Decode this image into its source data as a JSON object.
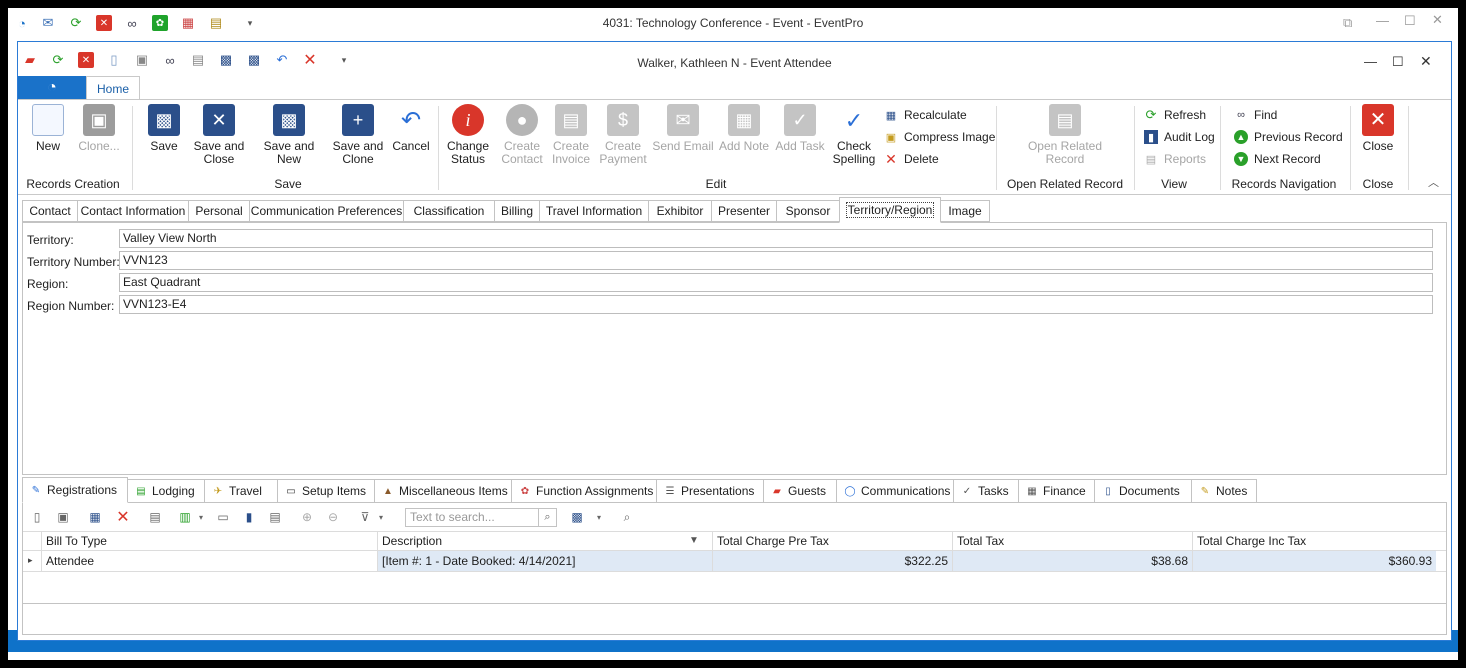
{
  "outer": {
    "title": "4031: Technology Conference - Event - EventPro"
  },
  "inner": {
    "title": "Walker, Kathleen N - Event Attendee"
  },
  "ribbon": {
    "home_tab": "Home",
    "groups": {
      "records_creation": "Records Creation",
      "save": "Save",
      "edit": "Edit",
      "open_related": "Open Related Record",
      "view": "View",
      "records_navigation": "Records Navigation",
      "close": "Close"
    },
    "buttons": {
      "new": "New",
      "clone": "Clone...",
      "save": "Save",
      "save_close_1": "Save and",
      "save_close_2": "Close",
      "save_new": "Save and New",
      "save_clone_1": "Save and",
      "save_clone_2": "Clone",
      "cancel": "Cancel",
      "change_status_1": "Change",
      "change_status_2": "Status",
      "create_contact_1": "Create",
      "create_contact_2": "Contact",
      "create_invoice_1": "Create",
      "create_invoice_2": "Invoice",
      "create_payment_1": "Create",
      "create_payment_2": "Payment",
      "send_email": "Send Email",
      "add_note": "Add Note",
      "add_task": "Add Task",
      "check_spelling_1": "Check",
      "check_spelling_2": "Spelling",
      "recalculate": "Recalculate",
      "compress_image": "Compress Image",
      "delete": "Delete",
      "open_related_1": "Open Related",
      "open_related_2": "Record",
      "refresh": "Refresh",
      "audit_log": "Audit Log",
      "reports": "Reports",
      "find": "Find",
      "previous_record": "Previous Record",
      "next_record": "Next Record",
      "close": "Close"
    }
  },
  "detail_tabs": [
    "Contact",
    "Contact Information",
    "Personal",
    "Communication Preferences",
    "Classification",
    "Billing",
    "Travel Information",
    "Exhibitor",
    "Presenter",
    "Sponsor",
    "Territory/Region",
    "Image"
  ],
  "fields": {
    "territory": {
      "label": "Territory:",
      "value": "Valley View North"
    },
    "territory_number": {
      "label": "Territory Number:",
      "value": "VVN123"
    },
    "region": {
      "label": "Region:",
      "value": "East Quadrant"
    },
    "region_number": {
      "label": "Region Number:",
      "value": "VVN123-E4"
    }
  },
  "bottom_tabs": [
    "Registrations",
    "Lodging",
    "Travel",
    "Setup Items",
    "Miscellaneous Items",
    "Function Assignments",
    "Presentations",
    "Guests",
    "Communications",
    "Tasks",
    "Finance",
    "Documents",
    "Notes"
  ],
  "search": {
    "placeholder": "Text to search..."
  },
  "grid": {
    "headers": [
      "Bill To Type",
      "Description",
      "Total Charge Pre Tax",
      "Total Tax",
      "Total Charge Inc Tax"
    ],
    "rows": [
      [
        "Attendee",
        "[Item #: 1 - Date Booked: 4/14/2021]",
        "$322.25",
        "$38.68",
        "$360.93"
      ]
    ]
  },
  "colors": {
    "accent": "#1a72c9",
    "status_bar": "#0f72c9",
    "close_red": "#d9362a"
  }
}
